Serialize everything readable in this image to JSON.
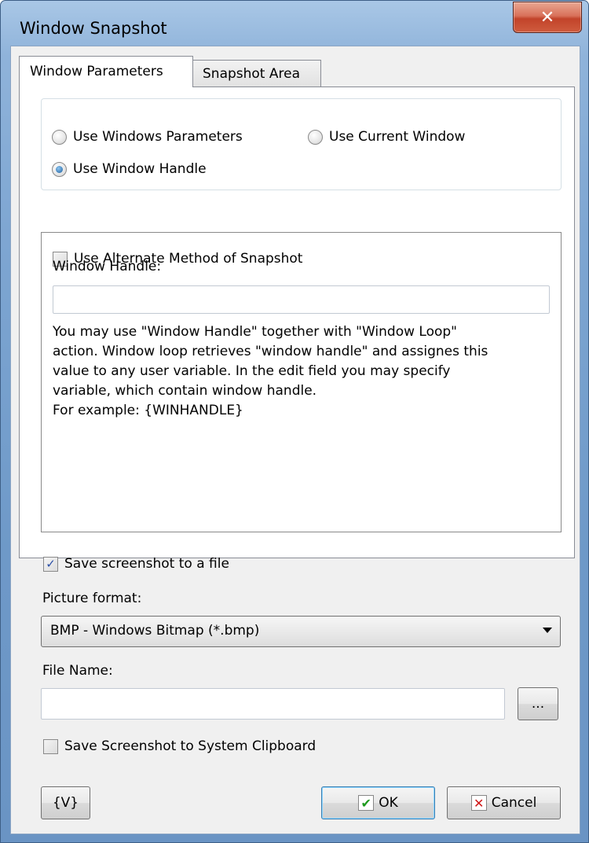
{
  "window": {
    "title": "Window Snapshot",
    "close_label": "✕"
  },
  "tabs": [
    {
      "label": "Window Parameters",
      "active": true
    },
    {
      "label": "Snapshot Area",
      "active": false
    }
  ],
  "window_mode": {
    "options": [
      {
        "label": "Use Windows Parameters",
        "checked": false
      },
      {
        "label": "Use Current Window",
        "checked": false
      },
      {
        "label": "Use Window Handle",
        "checked": true
      }
    ]
  },
  "alternate_method": {
    "label": "Use Alternate Method of Snapshot",
    "checked": false
  },
  "window_handle": {
    "label": "Window Handle:",
    "value": "",
    "help": "You may use \"Window Handle\" together with \"Window Loop\"\naction. Window loop retrieves \"window handle\" and assignes this\nvalue to any user variable. In the edit field you may specify\nvariable, which contain window handle.\nFor example: {WINHANDLE}"
  },
  "save_to_file": {
    "label": "Save screenshot to a file",
    "checked": true
  },
  "picture_format": {
    "label": "Picture format:",
    "selected": "BMP - Windows Bitmap (*.bmp)"
  },
  "file_name": {
    "label": "File Name:",
    "value": "",
    "browse_label": "..."
  },
  "save_to_clipboard": {
    "label": "Save Screenshot to System Clipboard",
    "checked": false
  },
  "footer": {
    "variables_label": "{V}",
    "ok_label": "OK",
    "cancel_label": "Cancel",
    "ok_icon": "✔",
    "cancel_icon": "✕"
  }
}
